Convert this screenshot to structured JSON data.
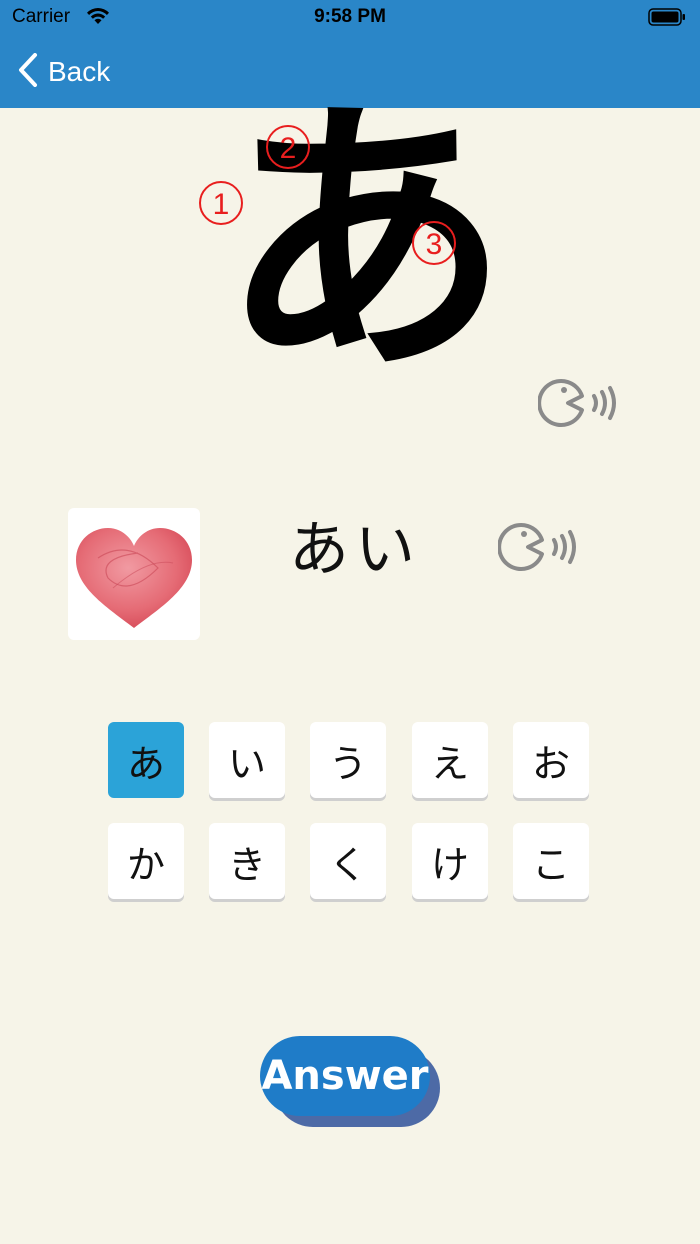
{
  "status_bar": {
    "carrier": "Carrier",
    "time": "9:58 PM"
  },
  "nav": {
    "back_label": "Back",
    "bar_color": "#2a86c8"
  },
  "character": {
    "glyph": "あ",
    "stroke_numbers": [
      "1",
      "2",
      "3"
    ],
    "stroke_color": "#e81e1e"
  },
  "word": {
    "text": "あい",
    "image": "heart-picture"
  },
  "keys": [
    {
      "label": "あ",
      "selected": true
    },
    {
      "label": "い",
      "selected": false
    },
    {
      "label": "う",
      "selected": false
    },
    {
      "label": "え",
      "selected": false
    },
    {
      "label": "お",
      "selected": false
    },
    {
      "label": "か",
      "selected": false
    },
    {
      "label": "き",
      "selected": false
    },
    {
      "label": "く",
      "selected": false
    },
    {
      "label": "け",
      "selected": false
    },
    {
      "label": "こ",
      "selected": false
    }
  ],
  "answer_button": {
    "label": "Answer"
  },
  "icons": {
    "back": "chevron-left-icon",
    "speaker": "speaker-icon",
    "wifi": "wifi-icon",
    "battery": "battery-icon"
  }
}
